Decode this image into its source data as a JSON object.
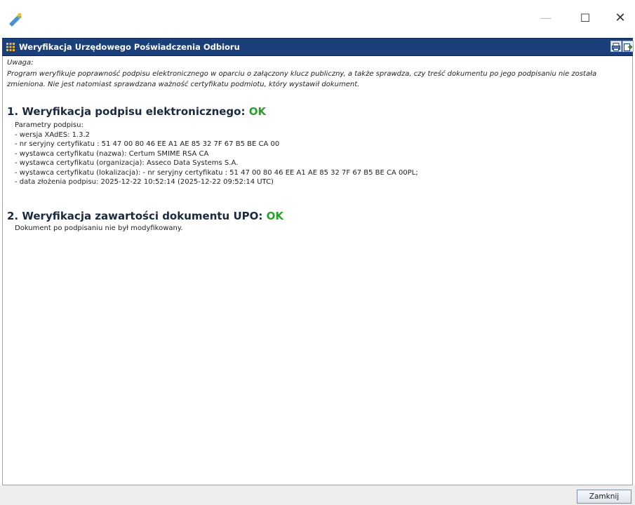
{
  "window": {
    "minimize_glyph": "—",
    "maximize_glyph": "☐",
    "close_glyph": "✕"
  },
  "header": {
    "title": "Weryfikacja Urzędowego Poświadczenia Odbioru"
  },
  "notice": {
    "label": "Uwaga:",
    "text": "Program weryfikuje poprawność podpisu elektronicznego w oparciu o załączony klucz publiczny, a także sprawdza, czy treść dokumentu po jego podpisaniu nie została zmieniona. Nie jest natomiast sprawdzana ważność certyfikatu podmiotu, który wystawił dokument."
  },
  "section1": {
    "title": "1. Weryfikacja podpisu elektronicznego:",
    "status": "OK",
    "params_heading": "Parametry podpisu:",
    "params": [
      "- wersja XAdES: 1.3.2",
      "- nr seryjny certyfikatu : 51 47 00 80 46 EE A1 AE 85 32 7F 67 B5 BE CA 00",
      "- wystawca certyfikatu (nazwa): Certum SMIME RSA CA",
      "- wystawca certyfikatu (organizacja): Asseco Data Systems S.A.",
      "- wystawca certyfikatu (lokalizacja): - nr seryjny certyfikatu : 51 47 00 80 46 EE A1 AE 85 32 7F 67 B5 BE CA 00PL;",
      "- data złożenia podpisu: 2025-12-22 10:52:14 (2025-12-22 09:52:14 UTC)"
    ]
  },
  "section2": {
    "title": "2. Weryfikacja zawartości dokumentu UPO:",
    "status": "OK",
    "description": "Dokument po podpisaniu nie był modyfikowany."
  },
  "footer": {
    "close_label": "Zamknij"
  },
  "colors": {
    "header_bg": "#1a3f7a",
    "ok_green": "#2aa02a"
  }
}
